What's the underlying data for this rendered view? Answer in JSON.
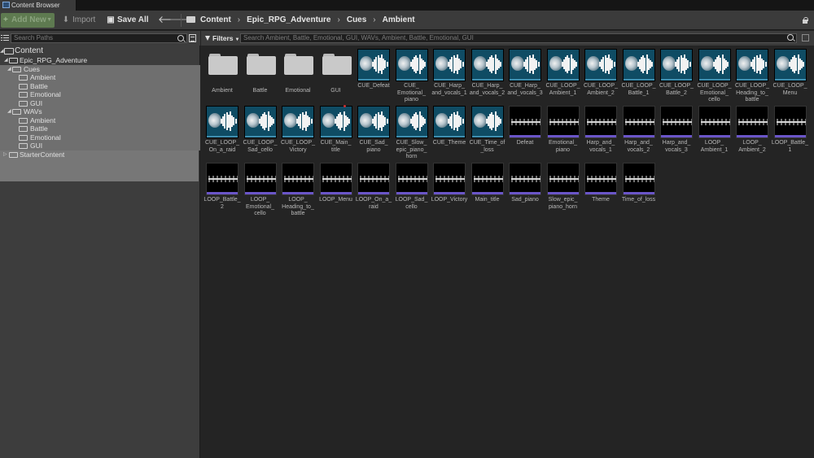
{
  "window": {
    "tab_title": "Content Browser"
  },
  "toolbar": {
    "add_new_label": "Add New",
    "import_label": "Import",
    "save_all_label": "Save All",
    "breadcrumbs": [
      "Content",
      "Epic_RPG_Adventure",
      "Cues",
      "Ambient"
    ]
  },
  "sources": {
    "search_placeholder": "Search Paths",
    "tree": {
      "root": "Content",
      "project": "Epic_RPG_Adventure",
      "cues": "Cues",
      "cue_children": [
        "Ambient",
        "Battle",
        "Emotional",
        "GUI"
      ],
      "wavs": "WAVs",
      "wav_children": [
        "Ambient",
        "Battle",
        "Emotional",
        "GUI"
      ],
      "starter": "StarterContent"
    }
  },
  "assets": {
    "filters_label": "Filters",
    "search_placeholder": "Search Ambient, Battle, Emotional, GUI, WAVs, Ambient, Battle, Emotional, GUI",
    "items": [
      {
        "label": "Ambient",
        "kind": "folder"
      },
      {
        "label": "Battle",
        "kind": "folder"
      },
      {
        "label": "Emotional",
        "kind": "folder"
      },
      {
        "label": "GUI",
        "kind": "folder"
      },
      {
        "label": "CUE_Defeat",
        "kind": "cue"
      },
      {
        "label": "CUE_\nEmotional_\npiano",
        "kind": "cue"
      },
      {
        "label": "CUE_Harp_\nand_vocals_1",
        "kind": "cue"
      },
      {
        "label": "CUE_Harp_\nand_vocals_2",
        "kind": "cue"
      },
      {
        "label": "CUE_Harp_\nand_vocals_3",
        "kind": "cue"
      },
      {
        "label": "CUE_LOOP_\nAmbient_1",
        "kind": "cue"
      },
      {
        "label": "CUE_LOOP_\nAmbient_2",
        "kind": "cue"
      },
      {
        "label": "CUE_LOOP_\nBattle_1",
        "kind": "cue"
      },
      {
        "label": "CUE_LOOP_\nBattle_2",
        "kind": "cue"
      },
      {
        "label": "CUE_LOOP_\nEmotional_\ncello",
        "kind": "cue"
      },
      {
        "label": "CUE_LOOP_\nHeading_to_\nbattle",
        "kind": "cue"
      },
      {
        "label": "CUE_LOOP_\nMenu",
        "kind": "cue"
      },
      {
        "label": "CUE_LOOP_\nOn_a_raid",
        "kind": "cue"
      },
      {
        "label": "CUE_LOOP_\nSad_cello",
        "kind": "cue"
      },
      {
        "label": "CUE_LOOP_\nVictory",
        "kind": "cue"
      },
      {
        "label": "CUE_Main_\ntitle",
        "kind": "cue",
        "dirty": true
      },
      {
        "label": "CUE_Sad_\npiano",
        "kind": "cue"
      },
      {
        "label": "CUE_Slow_\nepic_piano_\nhorn",
        "kind": "cue"
      },
      {
        "label": "CUE_Theme",
        "kind": "cue"
      },
      {
        "label": "CUE_Time_of\n_loss",
        "kind": "cue"
      },
      {
        "label": "Defeat",
        "kind": "wav"
      },
      {
        "label": "Emotional_\npiano",
        "kind": "wav"
      },
      {
        "label": "Harp_and_\nvocals_1",
        "kind": "wav"
      },
      {
        "label": "Harp_and_\nvocals_2",
        "kind": "wav"
      },
      {
        "label": "Harp_and_\nvocals_3",
        "kind": "wav"
      },
      {
        "label": "LOOP_\nAmbient_1",
        "kind": "wav"
      },
      {
        "label": "LOOP_\nAmbient_2",
        "kind": "wav"
      },
      {
        "label": "LOOP_Battle_\n1",
        "kind": "wav"
      },
      {
        "label": "LOOP_Battle_\n2",
        "kind": "wav"
      },
      {
        "label": "LOOP_\nEmotional_\ncello",
        "kind": "wav"
      },
      {
        "label": "LOOP_\nHeading_to_\nbattle",
        "kind": "wav"
      },
      {
        "label": "LOOP_Menu",
        "kind": "wav"
      },
      {
        "label": "LOOP_On_a_\nraid",
        "kind": "wav"
      },
      {
        "label": "LOOP_Sad_\ncello",
        "kind": "wav"
      },
      {
        "label": "LOOP_Victory",
        "kind": "wav"
      },
      {
        "label": "Main_title",
        "kind": "wav"
      },
      {
        "label": "Sad_piano",
        "kind": "wav"
      },
      {
        "label": "Slow_epic_\npiano_horn",
        "kind": "wav"
      },
      {
        "label": "Theme",
        "kind": "wav"
      },
      {
        "label": "Time_of_loss",
        "kind": "wav"
      }
    ]
  },
  "colors": {
    "cue_bg": "#0f4c64",
    "cue_underline": "#3f8fb0",
    "wav_underline": "#6a55c8",
    "selection": "#6f6f6f",
    "add_new": "#5e7a50"
  }
}
